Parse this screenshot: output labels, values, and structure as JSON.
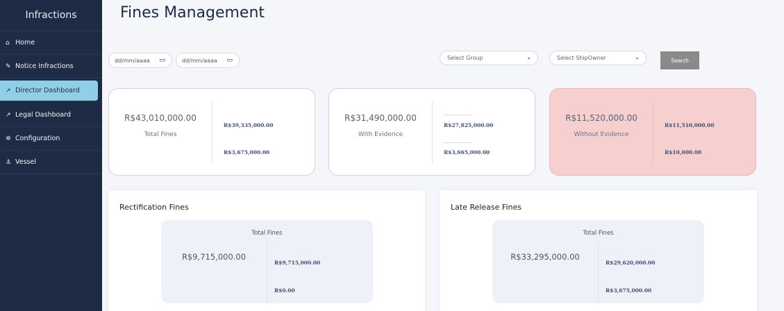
{
  "sidebar": {
    "brand": "Infractions",
    "items": [
      {
        "label": "Home",
        "icon": "⌂"
      },
      {
        "label": "Notice Infractions",
        "icon": "✎"
      },
      {
        "label": "Director Dashboard",
        "icon": "↗"
      },
      {
        "label": "Legal Dashboard",
        "icon": "↗"
      },
      {
        "label": "Configuration",
        "icon": "✲"
      },
      {
        "label": "Vessel",
        "icon": "⚓"
      }
    ]
  },
  "header": {
    "title": "Fines Management"
  },
  "filters": {
    "date_start_placeholder": "dd/mm/aaaa",
    "date_end_placeholder": "dd/mm/aaaa",
    "group_select": "Select Group",
    "shipowner_select": "Select ShipOwner",
    "search_label": "Search"
  },
  "cards": [
    {
      "value": "R$43,010,000.00",
      "label": "Total Fines",
      "sub1": "R$39,335,000.00",
      "sub2": "R$3,675,000.00"
    },
    {
      "value": "R$31,490,000.00",
      "label": "With Evidence",
      "sub1": "R$27,825,000.00",
      "sub2": "R$3,665,000.00"
    },
    {
      "value": "R$11,520,000.00",
      "label": "Without Evidence",
      "sub1": "R$11,510,000.00",
      "sub2": "R$10,000.00"
    }
  ],
  "panels": [
    {
      "title": "Rectification Fines",
      "total_label": "Total Fines",
      "value": "R$9,715,000.00",
      "sub1": "R$9,715,000.00",
      "sub2": "R$0.00"
    },
    {
      "title": "Late Release Fines",
      "total_label": "Total Fines",
      "value": "R$33,295,000.00",
      "sub1": "R$29,620,000.00",
      "sub2": "R$3,675,000.00"
    }
  ]
}
